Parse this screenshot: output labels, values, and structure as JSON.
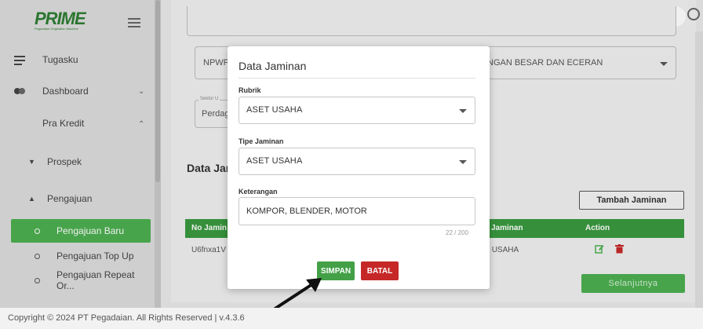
{
  "app": {
    "logo_text": "PRIME",
    "logo_subtext": "Pegadaian Origination Machine"
  },
  "sidebar": {
    "items": [
      {
        "label": "Tugasku",
        "icon": "list-icon"
      },
      {
        "label": "Dashboard",
        "icon": "dashboard-icon"
      },
      {
        "label": "Pra Kredit"
      },
      {
        "label": "Prospek"
      },
      {
        "label": "Pengajuan"
      },
      {
        "label": "Pengajuan Baru"
      },
      {
        "label": "Pengajuan Top Up"
      },
      {
        "label": "Pengajuan Repeat Or..."
      }
    ]
  },
  "form": {
    "npwp_label": "NPWP",
    "bidang_usaha_value": "NGAN BESAR DAN ECERAN",
    "sektor_label": "Sektor U",
    "sektor_value": "Perdag"
  },
  "section": {
    "title": "Data Jar",
    "add_button": "Tambah Jaminan",
    "next_button": "Selanjutnya"
  },
  "table": {
    "headers": [
      "No Jamin",
      "Jaminan",
      "Action"
    ],
    "rows": [
      {
        "no": "U6fnxa1V",
        "jaminan": "T USAHA"
      }
    ]
  },
  "modal": {
    "title": "Data Jaminan",
    "rubrik_label": "Rubrik",
    "rubrik_value": "ASET USAHA",
    "tipe_label": "Tipe Jaminan",
    "tipe_value": "ASET USAHA",
    "keterangan_label": "Keterangan",
    "keterangan_value": "KOMPOR, BLENDER, MOTOR",
    "counter": "22 / 200",
    "save_button": "SIMPAN",
    "cancel_button": "BATAL"
  },
  "footer": {
    "text": "Copyright © 2024 PT Pegadaian. All Rights Reserved | v.4.3.6"
  },
  "colors": {
    "primary_green": "#43a047",
    "danger_red": "#c62828",
    "table_header": "#3a9a3f"
  }
}
